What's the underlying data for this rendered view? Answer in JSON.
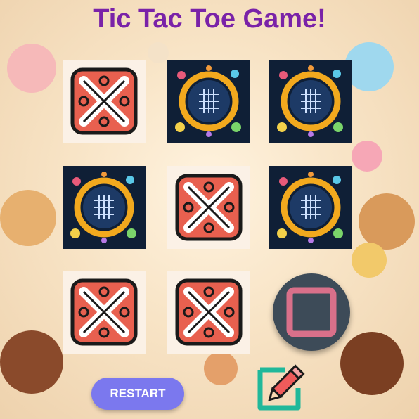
{
  "title": "Tic Tac Toe Game!",
  "board": [
    [
      "X",
      "O",
      "O"
    ],
    [
      "O",
      "X",
      "O"
    ],
    [
      "X",
      "X",
      ""
    ]
  ],
  "controls": {
    "restart_label": "RESTART"
  },
  "icons": {
    "x_tile": "x-mark-icon",
    "o_tile": "o-board-icon",
    "next_shape": "square-icon",
    "edit": "pencil-edit-icon"
  },
  "colors": {
    "title": "#7a22a8",
    "restart_bg": "#7b78ee",
    "x_mark": "#e8604f",
    "o_ring": "#f2a91e",
    "square_outline": "#d9708a"
  }
}
